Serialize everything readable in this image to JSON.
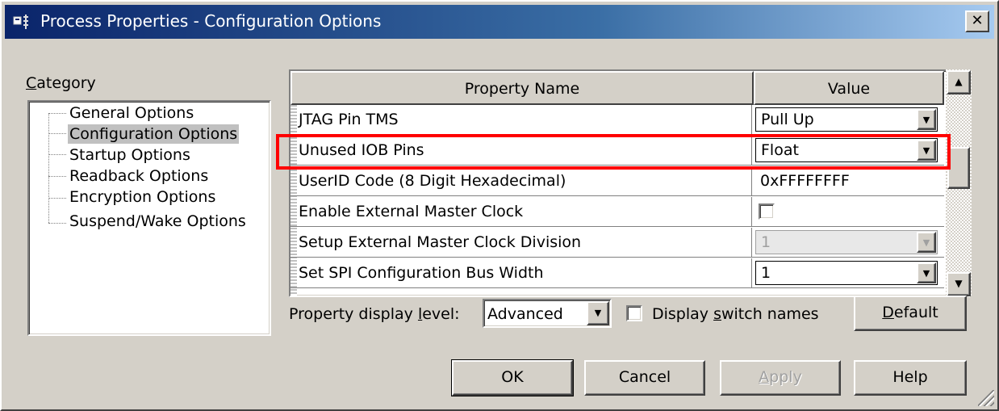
{
  "window": {
    "title": "Process Properties - Configuration Options",
    "close_glyph": "✕"
  },
  "category": {
    "label_prefix": "",
    "label_mnemonic": "C",
    "label_rest": "ategory",
    "items": [
      {
        "label": "General Options",
        "selected": false
      },
      {
        "label": "Configuration Options",
        "selected": true
      },
      {
        "label": "Startup Options",
        "selected": false
      },
      {
        "label": "Readback Options",
        "selected": false
      },
      {
        "label": "Encryption Options",
        "selected": false
      },
      {
        "label": "Suspend/Wake Options",
        "selected": false
      }
    ]
  },
  "grid": {
    "headers": {
      "name": "Property Name",
      "value": "Value"
    },
    "rows": [
      {
        "name": "JTAG Pin TMS",
        "value": "Pull Up",
        "kind": "combo",
        "enabled": true
      },
      {
        "name": "Unused IOB Pins",
        "value": "Float",
        "kind": "combo",
        "enabled": true
      },
      {
        "name": "UserID Code (8 Digit Hexadecimal)",
        "value": "0xFFFFFFFF",
        "kind": "text",
        "enabled": true
      },
      {
        "name": "Enable External Master Clock",
        "value": "",
        "kind": "checkbox",
        "checked": false,
        "enabled": true
      },
      {
        "name": "Setup External Master Clock Division",
        "value": "1",
        "kind": "combo",
        "enabled": false
      },
      {
        "name": "Set SPI Configuration Bus Width",
        "value": "1",
        "kind": "combo",
        "enabled": true
      }
    ],
    "highlighted_row": "Unused IOB Pins"
  },
  "display_level": {
    "label_pre": "Property display ",
    "label_mnemonic": "l",
    "label_post": "evel:",
    "selected": "Advanced"
  },
  "switch_names": {
    "label_pre": "Display ",
    "label_mnemonic": "s",
    "label_post": "witch names",
    "checked": false
  },
  "buttons": {
    "default_pre": "",
    "default_mnemonic": "D",
    "default_post": "efault",
    "ok": "OK",
    "cancel": "Cancel",
    "apply_mnemonic": "A",
    "apply_post": "pply",
    "help": "Help"
  },
  "icons": {
    "window": "properties-icon",
    "combo_arrow": "▼",
    "scroll_up": "▲",
    "scroll_down": "▼"
  },
  "colors": {
    "title_start": "#0a246a",
    "title_end": "#a6caf0",
    "highlight": "#ff0000",
    "face": "#d4d0c8"
  }
}
